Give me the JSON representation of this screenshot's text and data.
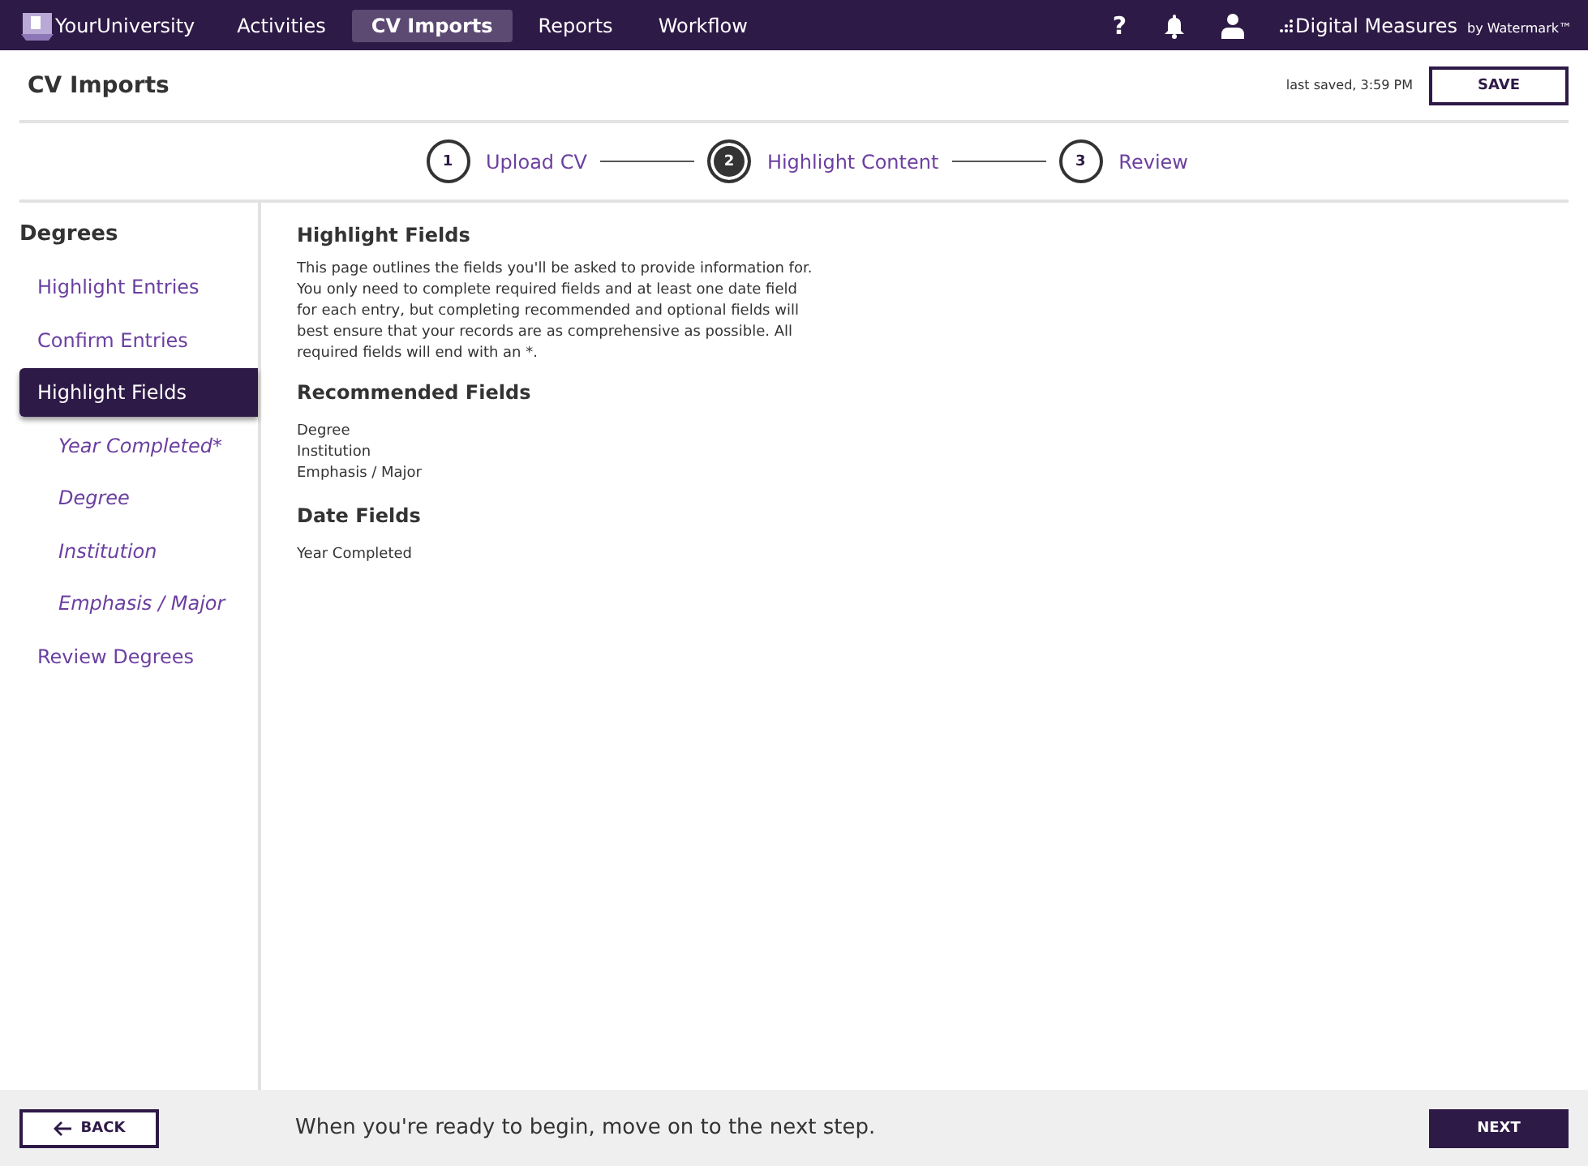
{
  "topbar": {
    "logo": "YourUniversity",
    "nav": [
      {
        "label": "Activities",
        "selected": false
      },
      {
        "label": "CV Imports",
        "selected": true
      },
      {
        "label": "Reports",
        "selected": false
      },
      {
        "label": "Workflow",
        "selected": false
      }
    ],
    "help": "?",
    "brand": "Digital Measures",
    "brand_suffix": "by Watermark™"
  },
  "header": {
    "title": "CV Imports",
    "last_saved": "last saved, 3:59 PM",
    "save": "SAVE"
  },
  "stepper": [
    {
      "number": "1",
      "label": "Upload CV",
      "selected": false
    },
    {
      "number": "2",
      "label": "Highlight Content",
      "selected": true
    },
    {
      "number": "3",
      "label": "Review",
      "selected": false
    }
  ],
  "sidebar": {
    "title": "Degrees",
    "items": [
      {
        "label": "Highlight Entries",
        "kind": "step",
        "selected": false
      },
      {
        "label": "Confirm Entries",
        "kind": "step",
        "selected": false
      },
      {
        "label": "Highlight Fields",
        "kind": "step",
        "selected": true
      },
      {
        "label": "Year Completed*",
        "kind": "field",
        "selected": false
      },
      {
        "label": "Degree",
        "kind": "field",
        "selected": false
      },
      {
        "label": "Institution",
        "kind": "field",
        "selected": false
      },
      {
        "label": "Emphasis / Major",
        "kind": "field",
        "selected": false
      },
      {
        "label": "Review Degrees",
        "kind": "step",
        "selected": false
      }
    ]
  },
  "content": {
    "title": "Highlight Fields",
    "intro": "This page outlines the fields you'll be asked to provide information for. You only need to complete required fields and at least one date field for each entry, but completing recommended and optional fields will best ensure that your records are as comprehensive as possible. All required fields will end with an *.",
    "sections": [
      {
        "heading": "Recommended Fields",
        "fields": [
          "Degree",
          "Institution",
          "Emphasis / Major"
        ]
      },
      {
        "heading": "Date Fields",
        "fields": [
          "Year Completed"
        ]
      }
    ]
  },
  "footer": {
    "back": "BACK",
    "message": "When you're ready to begin, move on to the next step.",
    "next": "NEXT"
  }
}
